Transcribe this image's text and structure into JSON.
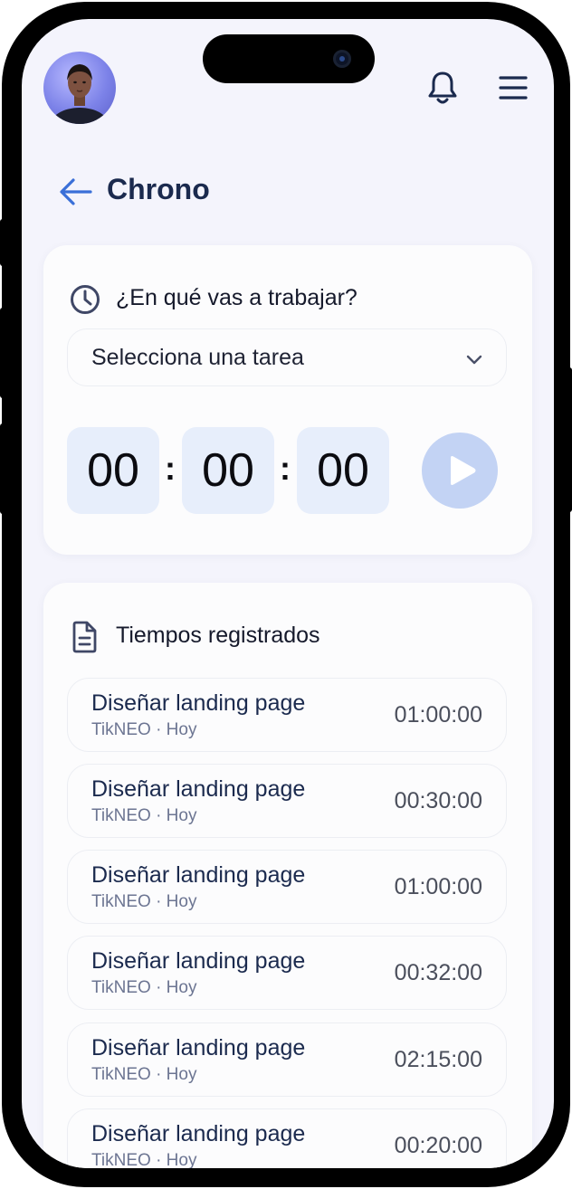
{
  "header": {
    "avatar_alt": "user-avatar",
    "notifications_icon": "bell-icon",
    "menu_icon": "hamburger-menu-icon"
  },
  "page": {
    "back_icon": "arrow-left-icon",
    "title": "Chrono"
  },
  "timer_card": {
    "question": "¿En qué vas a trabajar?",
    "select": {
      "value": "Selecciona una tarea"
    },
    "timer": {
      "hours": "00",
      "minutes": "00",
      "seconds": "00",
      "separator": ":"
    },
    "play_icon": "play-icon"
  },
  "log_card": {
    "title": "Tiempos registrados",
    "entries": [
      {
        "task": "Diseñar landing page",
        "meta": "TikNEO · Hoy",
        "duration": "01:00:00"
      },
      {
        "task": "Diseñar landing page",
        "meta": "TikNEO · Hoy",
        "duration": "00:30:00"
      },
      {
        "task": "Diseñar landing page",
        "meta": "TikNEO · Hoy",
        "duration": "01:00:00"
      },
      {
        "task": "Diseñar landing page",
        "meta": "TikNEO · Hoy",
        "duration": "00:32:00"
      },
      {
        "task": "Diseñar landing page",
        "meta": "TikNEO · Hoy",
        "duration": "02:15:00"
      },
      {
        "task": "Diseñar landing page",
        "meta": "TikNEO · Hoy",
        "duration": "00:20:00"
      }
    ]
  },
  "colors": {
    "background": "#f4f4fc",
    "primary_text": "#1b2a4e",
    "accent": "#3a6fd8",
    "timer_box": "#e7eefb",
    "play_button": "#c3d3f4"
  }
}
